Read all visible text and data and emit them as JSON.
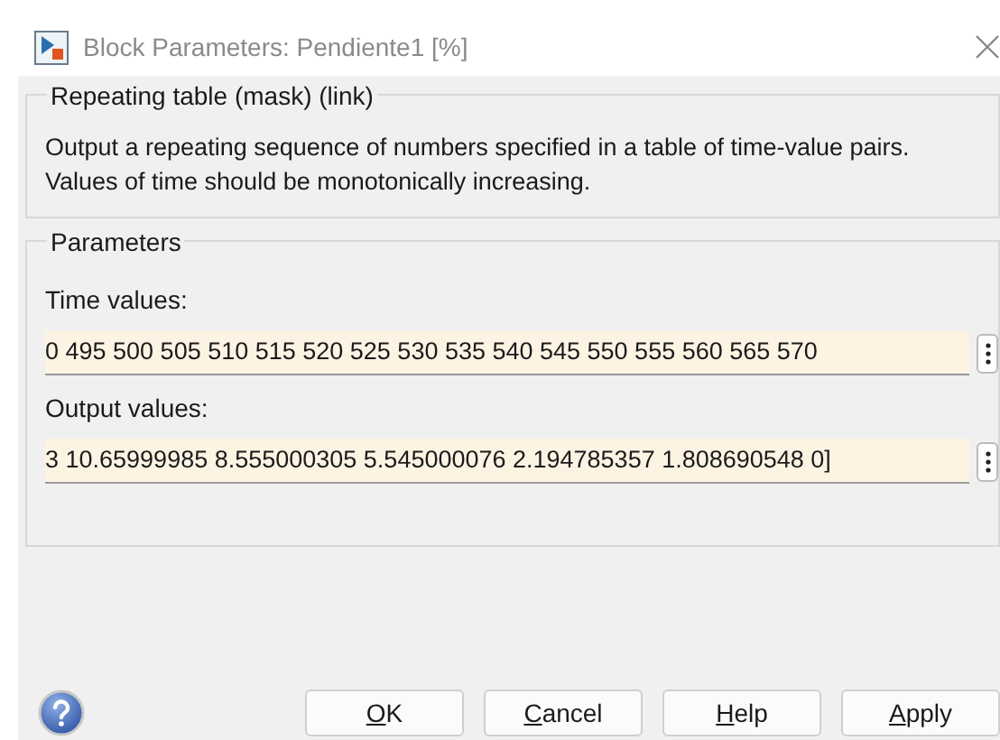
{
  "window": {
    "title": "Block Parameters: Pendiente1 [%]"
  },
  "mask": {
    "title": "Repeating table (mask) (link)",
    "description": "Output a repeating sequence of numbers specified in a table of time-value pairs. Values of time should be monotonically increasing."
  },
  "parameters": {
    "title": "Parameters",
    "fields": [
      {
        "label": "Time values:",
        "value": "0 495 500 505 510 515 520 525 530 535 540 545 550 555 560 565 570"
      },
      {
        "label": "Output values:",
        "value": "3 10.65999985 8.555000305 5.545000076 2.194785357 1.808690548 0]"
      }
    ]
  },
  "buttons": [
    {
      "mnemonic": "O",
      "rest": "K"
    },
    {
      "mnemonic": "C",
      "rest": "ancel"
    },
    {
      "mnemonic": "H",
      "rest": "elp"
    },
    {
      "mnemonic": "A",
      "rest": "pply"
    }
  ]
}
